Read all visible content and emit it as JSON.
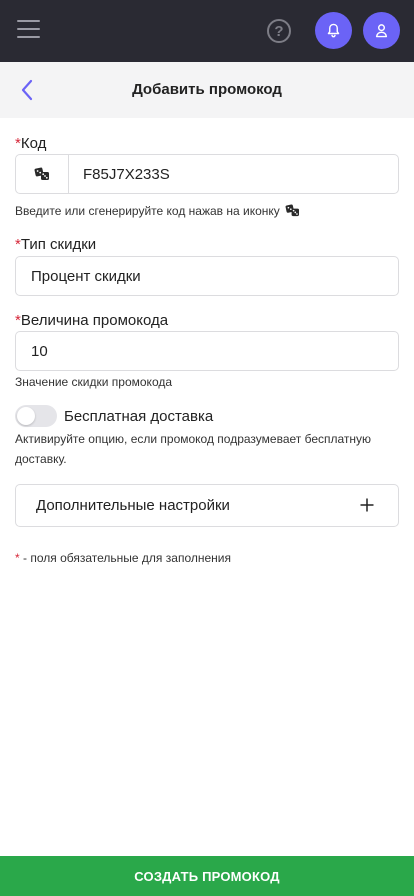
{
  "topbar": {
    "menu_icon": "hamburger-menu-icon",
    "help_icon": "question-circle-icon",
    "help_glyph": "?",
    "bell_icon": "bell-icon",
    "user_icon": "user-icon",
    "accent_color": "#6b63f6",
    "background_color": "#2a2a33"
  },
  "header": {
    "back_icon": "chevron-left-icon",
    "title": "Добавить промокод"
  },
  "form": {
    "required_mark": "*",
    "code": {
      "label": "Код",
      "value": "F85J7X233S",
      "dice_icon": "dice-icon",
      "hint": "Введите или сгенерируйте код нажав на иконку"
    },
    "discount_type": {
      "label": "Тип скидки",
      "value": "Процент скидки"
    },
    "promo_amount": {
      "label": "Величина промокода",
      "value": "10",
      "hint": "Значение скидки промокода"
    },
    "free_delivery": {
      "label": "Бесплатная доставка",
      "enabled": false,
      "hint": "Активируйте опцию, если промокод подразумевает бесплатную доставку."
    },
    "advanced": {
      "label": "Дополнительные настройки",
      "expand_icon": "plus-icon"
    },
    "required_note": "- поля обязательные для заполнения"
  },
  "footer": {
    "create_label": "СОЗДАТЬ ПРОМОКОД",
    "button_color": "#2aa84a"
  }
}
